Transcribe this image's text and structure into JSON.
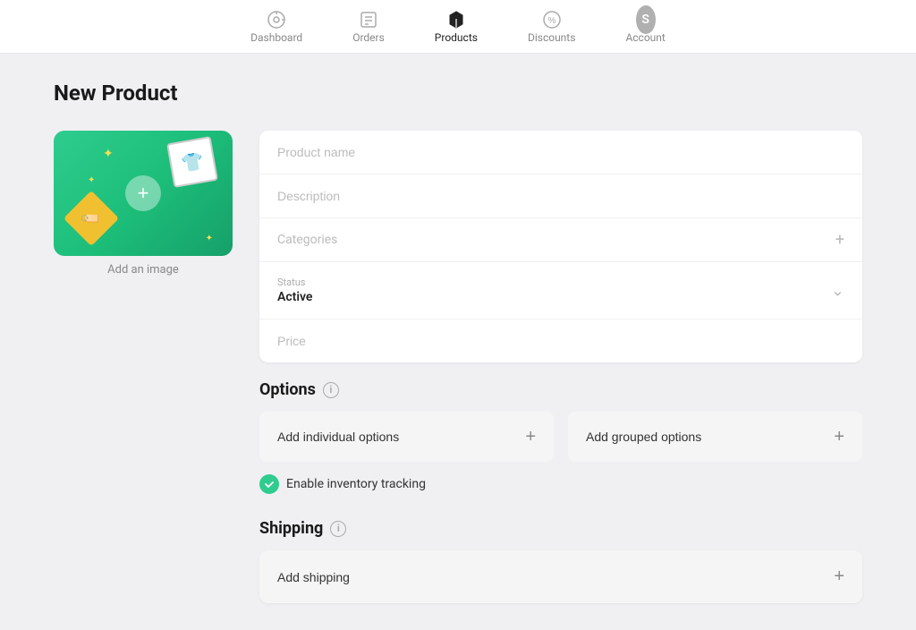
{
  "nav": {
    "items": [
      {
        "id": "dashboard",
        "label": "Dashboard",
        "active": false
      },
      {
        "id": "orders",
        "label": "Orders",
        "active": false
      },
      {
        "id": "products",
        "label": "Products",
        "active": true
      },
      {
        "id": "discounts",
        "label": "Discounts",
        "active": false
      },
      {
        "id": "account",
        "label": "Account",
        "active": false
      }
    ]
  },
  "page": {
    "title": "New Product"
  },
  "image": {
    "caption": "Add an image"
  },
  "form": {
    "product_name_placeholder": "Product name",
    "description_placeholder": "Description",
    "categories_placeholder": "Categories",
    "status_label": "Status",
    "status_value": "Active",
    "price_placeholder": "Price"
  },
  "options": {
    "heading": "Options",
    "add_individual_label": "Add individual options",
    "add_grouped_label": "Add grouped options",
    "inventory_label": "Enable inventory tracking"
  },
  "shipping": {
    "heading": "Shipping",
    "add_shipping_label": "Add shipping"
  },
  "account": {
    "initial": "S"
  }
}
